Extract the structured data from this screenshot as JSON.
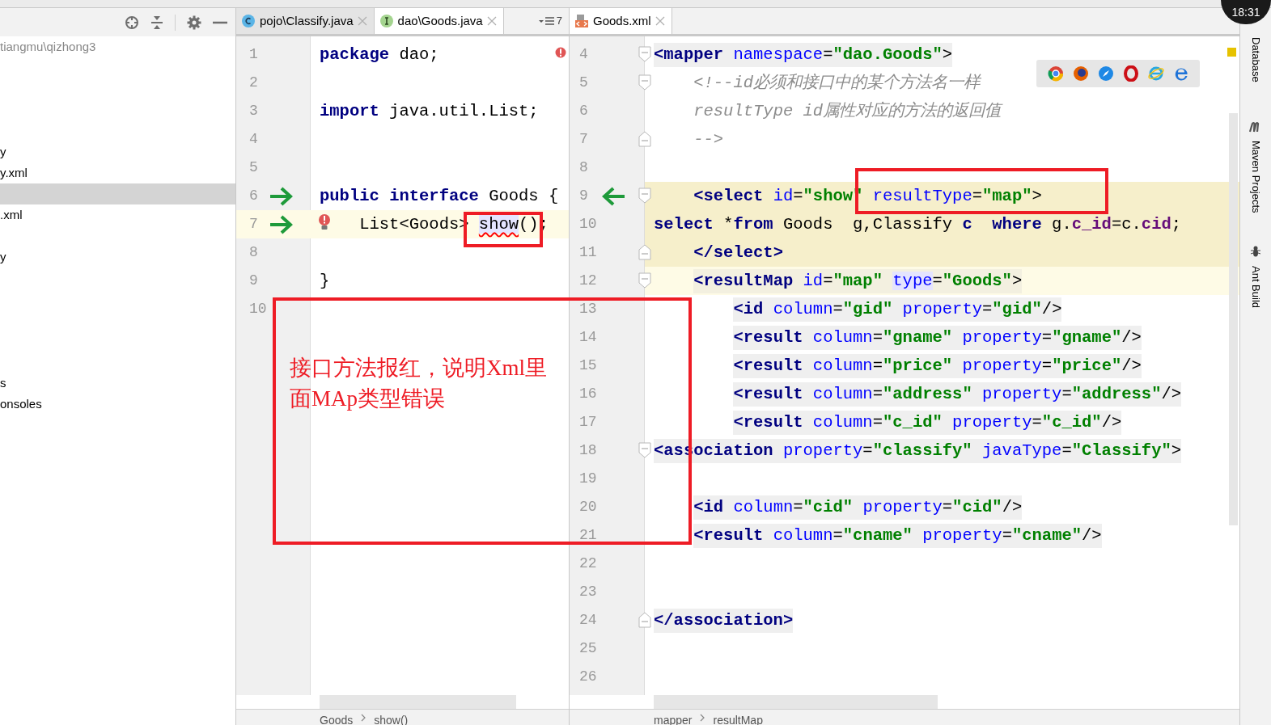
{
  "project_panel": {
    "rows": [
      {
        "text": "tiangmu\\qizhong3",
        "kind": "path",
        "selected": false
      },
      {
        "selected": false
      },
      {
        "selected": false
      },
      {
        "selected": false
      },
      {
        "selected": false
      },
      {
        "text": "y",
        "kind": "file",
        "selected": false
      },
      {
        "text": "y.xml",
        "kind": "file",
        "selected": false
      },
      {
        "selected": true
      },
      {
        "text": ".xml",
        "kind": "file",
        "selected": false
      },
      {
        "selected": false
      },
      {
        "text": "y",
        "kind": "file",
        "selected": false
      },
      {
        "selected": false
      },
      {
        "selected": false
      },
      {
        "selected": false
      },
      {
        "selected": false
      },
      {
        "selected": false
      },
      {
        "text": "s",
        "kind": "file",
        "selected": false
      },
      {
        "text": "onsoles",
        "kind": "file",
        "selected": false
      }
    ]
  },
  "left_editor": {
    "tabs": [
      {
        "label": "pojo\\Classify.java",
        "kind": "class",
        "selected": false
      },
      {
        "label": "dao\\Goods.java",
        "kind": "interface",
        "selected": true
      }
    ],
    "tab_overflow": "7",
    "lines": [
      {
        "number": "1",
        "tokens": [
          {
            "kind": "kw",
            "text": "package"
          },
          {
            "kind": "plain",
            "text": " dao;"
          }
        ]
      },
      {
        "number": "2"
      },
      {
        "number": "3",
        "tokens": [
          {
            "kind": "kw",
            "text": "import"
          },
          {
            "kind": "plain",
            "text": " java.util.List;"
          }
        ]
      },
      {
        "number": "4"
      },
      {
        "number": "5"
      },
      {
        "number": "6",
        "arrow": true,
        "tokens": [
          {
            "kind": "kw",
            "text": "public "
          },
          {
            "kind": "kw",
            "text": "interface"
          },
          {
            "kind": "plain",
            "text": " Goods {"
          }
        ]
      },
      {
        "number": "7",
        "arrow": true,
        "current": true,
        "bulb": true,
        "tokens": [
          {
            "kind": "plain",
            "text": "    List<Goods> "
          },
          {
            "kind": "error",
            "text": "show",
            "highlight": true
          },
          {
            "kind": "plain",
            "text": "();"
          }
        ]
      },
      {
        "number": "8"
      },
      {
        "number": "9",
        "tokens": [
          {
            "kind": "plain",
            "text": "}"
          }
        ]
      },
      {
        "number": "10"
      }
    ],
    "breadcrumbs": [
      "Goods",
      "show()"
    ]
  },
  "right_editor": {
    "tabs": [
      {
        "label": "Goods.xml",
        "kind": "xml",
        "selected": true
      }
    ],
    "lines": [
      {
        "number": "4",
        "fold_start": true,
        "shaded": true,
        "tokens": [
          {
            "kind": "tag",
            "text": "<mapper"
          },
          {
            "kind": "attr",
            "text": " namespace"
          },
          {
            "kind": "punct",
            "text": "="
          },
          {
            "kind": "value",
            "text": "\"dao.Goods\""
          },
          {
            "kind": "punct",
            "text": ">"
          }
        ]
      },
      {
        "number": "5",
        "fold_start": true,
        "tokens": [
          {
            "kind": "comment",
            "text": "    <!--id必须和接口中的某个方法名一样"
          }
        ]
      },
      {
        "number": "6",
        "tokens": [
          {
            "kind": "comment",
            "text": "    resultType id属性对应的方法的返回值"
          }
        ]
      },
      {
        "number": "7",
        "fold_end": true,
        "tokens": [
          {
            "kind": "comment",
            "text": "    -->"
          }
        ]
      },
      {
        "number": "8"
      },
      {
        "number": "9",
        "fold_start": true,
        "matched": true,
        "arrow": true,
        "tokens": [
          {
            "kind": "tag",
            "text": "    <select"
          },
          {
            "kind": "attr",
            "text": " id"
          },
          {
            "kind": "punct",
            "text": "="
          },
          {
            "kind": "value",
            "text": "\"show\""
          },
          {
            "kind": "attr",
            "text": " resultType"
          },
          {
            "kind": "punct",
            "text": "="
          },
          {
            "kind": "value",
            "text": "\"map\""
          },
          {
            "kind": "punct",
            "text": ">"
          }
        ]
      },
      {
        "number": "10",
        "matched": true,
        "tokens": [
          {
            "kind": "kw",
            "text": "select"
          },
          {
            "kind": "plain",
            "text": " *"
          },
          {
            "kind": "kw",
            "text": "from"
          },
          {
            "kind": "plain",
            "text": " Goods  g,Classify "
          },
          {
            "kind": "kw",
            "text": "c  "
          },
          {
            "kind": "kw",
            "text": "where"
          },
          {
            "kind": "plain",
            "text": " g."
          },
          {
            "kind": "field",
            "text": "c_id"
          },
          {
            "kind": "plain",
            "text": "=c."
          },
          {
            "kind": "field",
            "text": "cid"
          },
          {
            "kind": "plain",
            "text": ";"
          }
        ]
      },
      {
        "number": "11",
        "fold_end": true,
        "matched": true,
        "tokens": [
          {
            "kind": "tag",
            "text": "    </select>"
          }
        ]
      },
      {
        "number": "12",
        "fold_start": true,
        "current": true,
        "shaded": true,
        "tokens": [
          {
            "kind": "tag",
            "text": "    <resultMap"
          },
          {
            "kind": "attr",
            "text": " id"
          },
          {
            "kind": "punct",
            "text": "="
          },
          {
            "kind": "value",
            "text": "\"map\" "
          },
          {
            "kind": "attr",
            "text": "type",
            "highlight": true
          },
          {
            "kind": "punct",
            "text": "="
          },
          {
            "kind": "value",
            "text": "\"Goods\""
          },
          {
            "kind": "punct",
            "text": ">"
          }
        ]
      },
      {
        "number": "13",
        "shaded": true,
        "tokens": [
          {
            "kind": "tag",
            "text": "        <id"
          },
          {
            "kind": "attr",
            "text": " column"
          },
          {
            "kind": "punct",
            "text": "="
          },
          {
            "kind": "value",
            "text": "\"gid\""
          },
          {
            "kind": "attr",
            "text": " property"
          },
          {
            "kind": "punct",
            "text": "="
          },
          {
            "kind": "value",
            "text": "\"gid\""
          },
          {
            "kind": "punct",
            "text": "/>"
          }
        ]
      },
      {
        "number": "14",
        "shaded": true,
        "tokens": [
          {
            "kind": "tag",
            "text": "        <result"
          },
          {
            "kind": "attr",
            "text": " column"
          },
          {
            "kind": "punct",
            "text": "="
          },
          {
            "kind": "value",
            "text": "\"gname\""
          },
          {
            "kind": "attr",
            "text": " property"
          },
          {
            "kind": "punct",
            "text": "="
          },
          {
            "kind": "value",
            "text": "\"gname\""
          },
          {
            "kind": "punct",
            "text": "/>"
          }
        ]
      },
      {
        "number": "15",
        "shaded": true,
        "tokens": [
          {
            "kind": "tag",
            "text": "        <result"
          },
          {
            "kind": "attr",
            "text": " column"
          },
          {
            "kind": "punct",
            "text": "="
          },
          {
            "kind": "value",
            "text": "\"price\""
          },
          {
            "kind": "attr",
            "text": " property"
          },
          {
            "kind": "punct",
            "text": "="
          },
          {
            "kind": "value",
            "text": "\"price\""
          },
          {
            "kind": "punct",
            "text": "/>"
          }
        ]
      },
      {
        "number": "16",
        "shaded": true,
        "tokens": [
          {
            "kind": "tag",
            "text": "        <result"
          },
          {
            "kind": "attr",
            "text": " column"
          },
          {
            "kind": "punct",
            "text": "="
          },
          {
            "kind": "value",
            "text": "\"address\""
          },
          {
            "kind": "attr",
            "text": " property"
          },
          {
            "kind": "punct",
            "text": "="
          },
          {
            "kind": "value",
            "text": "\"address\""
          },
          {
            "kind": "punct",
            "text": "/>"
          }
        ]
      },
      {
        "number": "17",
        "shaded": true,
        "tokens": [
          {
            "kind": "tag",
            "text": "        <result"
          },
          {
            "kind": "attr",
            "text": " column"
          },
          {
            "kind": "punct",
            "text": "="
          },
          {
            "kind": "value",
            "text": "\"c_id\""
          },
          {
            "kind": "attr",
            "text": " property"
          },
          {
            "kind": "punct",
            "text": "="
          },
          {
            "kind": "value",
            "text": "\"c_id\""
          },
          {
            "kind": "punct",
            "text": "/>"
          }
        ]
      },
      {
        "number": "18",
        "fold_start": true,
        "shaded": true,
        "tokens": [
          {
            "kind": "tag",
            "text": "<association"
          },
          {
            "kind": "attr",
            "text": " property"
          },
          {
            "kind": "punct",
            "text": "="
          },
          {
            "kind": "value",
            "text": "\"classify\""
          },
          {
            "kind": "attr",
            "text": " javaType"
          },
          {
            "kind": "punct",
            "text": "="
          },
          {
            "kind": "value",
            "text": "\"Classify\""
          },
          {
            "kind": "punct",
            "text": ">"
          }
        ]
      },
      {
        "number": "19"
      },
      {
        "number": "20",
        "shaded": true,
        "tokens": [
          {
            "kind": "tag",
            "text": "    <id"
          },
          {
            "kind": "attr",
            "text": " column"
          },
          {
            "kind": "punct",
            "text": "="
          },
          {
            "kind": "value",
            "text": "\"cid\""
          },
          {
            "kind": "attr",
            "text": " property"
          },
          {
            "kind": "punct",
            "text": "="
          },
          {
            "kind": "value",
            "text": "\"cid\""
          },
          {
            "kind": "punct",
            "text": "/>"
          }
        ]
      },
      {
        "number": "21",
        "shaded": true,
        "tokens": [
          {
            "kind": "tag",
            "text": "    <result"
          },
          {
            "kind": "attr",
            "text": " column"
          },
          {
            "kind": "punct",
            "text": "="
          },
          {
            "kind": "value",
            "text": "\"cname\""
          },
          {
            "kind": "attr",
            "text": " property"
          },
          {
            "kind": "punct",
            "text": "="
          },
          {
            "kind": "value",
            "text": "\"cname\""
          },
          {
            "kind": "punct",
            "text": "/>"
          }
        ]
      },
      {
        "number": "22"
      },
      {
        "number": "23"
      },
      {
        "number": "24",
        "fold_end": true,
        "shaded": true,
        "tokens": [
          {
            "kind": "tag",
            "text": "</association>"
          }
        ]
      },
      {
        "number": "25"
      },
      {
        "number": "26"
      }
    ],
    "breadcrumbs": [
      "mapper",
      "resultMap"
    ]
  },
  "tool_strip": [
    "Database",
    "Maven Projects",
    "Ant Build"
  ],
  "clock": "18:31",
  "annotation": {
    "note": "接口方法报红，说明Xml里面MAp类型错误"
  }
}
